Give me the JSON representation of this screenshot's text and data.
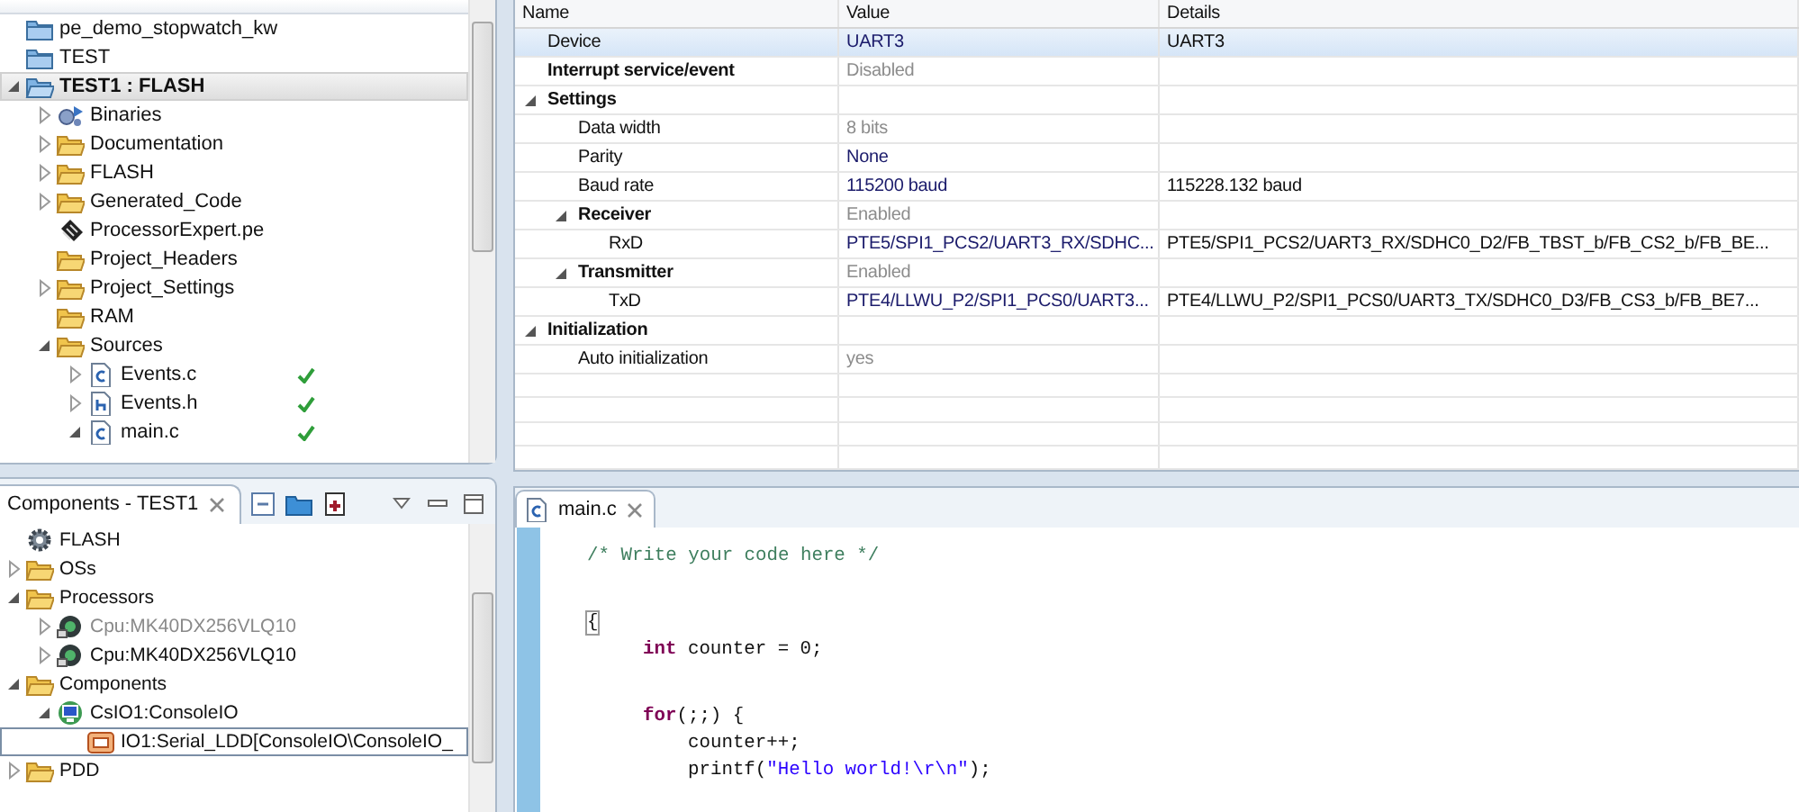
{
  "project_explorer": {
    "items": [
      {
        "label": "pe_demo_stopwatch_kw",
        "kind": "project",
        "selected": false
      },
      {
        "label": "TEST",
        "kind": "project",
        "selected": false
      },
      {
        "label": "TEST1 : FLASH",
        "kind": "active-project",
        "expanded": true,
        "selected": true,
        "children": [
          {
            "label": "Binaries",
            "kind": "binaries",
            "expanded": false,
            "selected": false
          },
          {
            "label": "Documentation",
            "kind": "folder",
            "expanded": false,
            "selected": false
          },
          {
            "label": "FLASH",
            "kind": "folder",
            "expanded": false,
            "selected": false
          },
          {
            "label": "Generated_Code",
            "kind": "folder",
            "expanded": false,
            "selected": false
          },
          {
            "label": "ProcessorExpert.pe",
            "kind": "pe-file",
            "selected": false
          },
          {
            "label": "Project_Headers",
            "kind": "folder",
            "selected": false
          },
          {
            "label": "Project_Settings",
            "kind": "folder",
            "expanded": false,
            "selected": false
          },
          {
            "label": "RAM",
            "kind": "folder",
            "selected": false
          },
          {
            "label": "Sources",
            "kind": "folder",
            "expanded": true,
            "selected": false,
            "children": [
              {
                "label": "Events.c",
                "kind": "c-file",
                "expanded": false,
                "selected": false,
                "build_ok": true
              },
              {
                "label": "Events.h",
                "kind": "h-file",
                "expanded": false,
                "selected": false,
                "build_ok": true
              },
              {
                "label": "main.c",
                "kind": "c-file",
                "expanded": true,
                "selected": false,
                "build_ok": true
              }
            ]
          }
        ]
      }
    ]
  },
  "components_view": {
    "tab": "Components - TEST1",
    "items": [
      {
        "label": "FLASH",
        "kind": "gear",
        "selected": false
      },
      {
        "label": "OSs",
        "kind": "folder",
        "expanded": false,
        "selected": false
      },
      {
        "label": "Processors",
        "kind": "folder",
        "expanded": true,
        "selected": false,
        "children": [
          {
            "label": "Cpu:MK40DX256VLQ10",
            "kind": "cpu",
            "expanded": false,
            "disabled": true,
            "selected": false
          },
          {
            "label": "Cpu:MK40DX256VLQ10",
            "kind": "cpu",
            "expanded": false,
            "disabled": false,
            "selected": false
          }
        ]
      },
      {
        "label": "Components",
        "kind": "folder",
        "expanded": true,
        "selected": false,
        "children": [
          {
            "label": "CsIO1:ConsoleIO",
            "kind": "component",
            "expanded": true,
            "selected": false,
            "children": [
              {
                "label": "IO1:Serial_LDD[ConsoleIO\\ConsoleIO_",
                "kind": "serial",
                "selected": true
              }
            ]
          }
        ]
      },
      {
        "label": "PDD",
        "kind": "folder",
        "expanded": false,
        "selected": false
      }
    ]
  },
  "properties": {
    "columns": [
      "Name",
      "Value",
      "Details"
    ],
    "rows": [
      {
        "kind": "property",
        "name": "Device",
        "value": "UART3",
        "details": "UART3",
        "read_only": false,
        "selected": true
      },
      {
        "kind": "group",
        "name": "Interrupt service/event",
        "value": "Disabled",
        "read_only": true,
        "selected": false
      },
      {
        "kind": "group",
        "name": "Settings",
        "expanded": true,
        "selected": false,
        "children": [
          {
            "kind": "property",
            "name": "Data width",
            "value": "8 bits",
            "read_only": true,
            "selected": false
          },
          {
            "kind": "property",
            "name": "Parity",
            "value": "None",
            "read_only": false,
            "selected": false
          },
          {
            "kind": "property",
            "name": "Baud rate",
            "value": "115200 baud",
            "details": "115228.132 baud",
            "read_only": false,
            "selected": false
          },
          {
            "kind": "group",
            "name": "Receiver",
            "value": "Enabled",
            "read_only": true,
            "expanded": true,
            "selected": false,
            "children": [
              {
                "kind": "property",
                "name": "RxD",
                "value": "PTE5/SPI1_PCS2/UART3_RX/SDHC...",
                "details": "PTE5/SPI1_PCS2/UART3_RX/SDHC0_D2/FB_TBST_b/FB_CS2_b/FB_BE...",
                "read_only": false,
                "selected": false
              }
            ]
          },
          {
            "kind": "group",
            "name": "Transmitter",
            "value": "Enabled",
            "read_only": true,
            "expanded": true,
            "selected": false,
            "children": [
              {
                "kind": "property",
                "name": "TxD",
                "value": "PTE4/LLWU_P2/SPI1_PCS0/UART3...",
                "details": "PTE4/LLWU_P2/SPI1_PCS0/UART3_TX/SDHC0_D3/FB_CS3_b/FB_BE7...",
                "read_only": false,
                "selected": false
              }
            ]
          }
        ]
      },
      {
        "kind": "group",
        "name": "Initialization",
        "expanded": true,
        "selected": false,
        "children": [
          {
            "kind": "property",
            "name": "Auto initialization",
            "value": "yes",
            "read_only": true,
            "selected": false
          }
        ]
      }
    ]
  },
  "editor": {
    "tab": "main.c",
    "lines": [
      {
        "kind": "top",
        "tokens": [
          {
            "kind": "comment",
            "text": "/* Write your code here */"
          }
        ]
      },
      {
        "kind": "blank"
      },
      {
        "kind": "top",
        "tokens": [
          {
            "kind": "bracket-match",
            "text": "{"
          }
        ]
      },
      {
        "kind": "block",
        "tokens": [
          {
            "kind": "keyword",
            "text": "int"
          },
          {
            "kind": "plain",
            "text": " counter = 0;"
          }
        ]
      },
      {
        "kind": "blank"
      },
      {
        "kind": "block",
        "tokens": [
          {
            "kind": "keyword",
            "text": "for"
          },
          {
            "kind": "plain",
            "text": "(;;) {"
          }
        ]
      },
      {
        "kind": "nested",
        "tokens": [
          {
            "kind": "plain",
            "text": "counter++;"
          }
        ]
      },
      {
        "kind": "nested",
        "tokens": [
          {
            "kind": "plain",
            "text": "printf("
          },
          {
            "kind": "string",
            "text": "\"Hello world!\\r\\n\""
          },
          {
            "kind": "plain",
            "text": ");"
          }
        ]
      }
    ]
  }
}
